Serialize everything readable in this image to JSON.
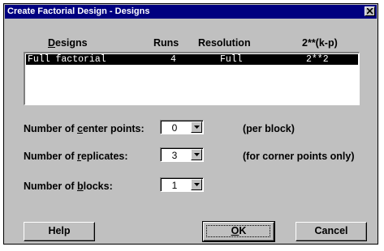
{
  "window": {
    "title": "Create Factorial Design - Designs"
  },
  "table": {
    "headers": {
      "designs_pre": "",
      "designs_u": "D",
      "designs_post": "esigns",
      "runs": "Runs",
      "resolution": "Resolution",
      "notation": "2**(k-p)"
    },
    "rows": [
      {
        "design": "Full factorial",
        "runs": "4",
        "resolution": "Full",
        "notation": "2**2",
        "selected": true
      }
    ]
  },
  "fields": {
    "center_points": {
      "label_pre": "Number of ",
      "label_u": "c",
      "label_post": "enter points:",
      "value": "0",
      "note": "(per block)"
    },
    "replicates": {
      "label_pre": "Number of ",
      "label_u": "r",
      "label_post": "eplicates:",
      "value": "3",
      "note": "(for corner points only)"
    },
    "blocks": {
      "label_pre": "Number of ",
      "label_u": "b",
      "label_post": "locks:",
      "value": "1"
    }
  },
  "buttons": {
    "help": "Help",
    "ok_u": "O",
    "ok_post": "K",
    "cancel": "Cancel"
  },
  "icons": {
    "close": "close-icon",
    "dropdown": "chevron-down-icon"
  },
  "colors": {
    "titlebar": "#000080",
    "face": "#c0c0c0",
    "selection": "#000000"
  }
}
